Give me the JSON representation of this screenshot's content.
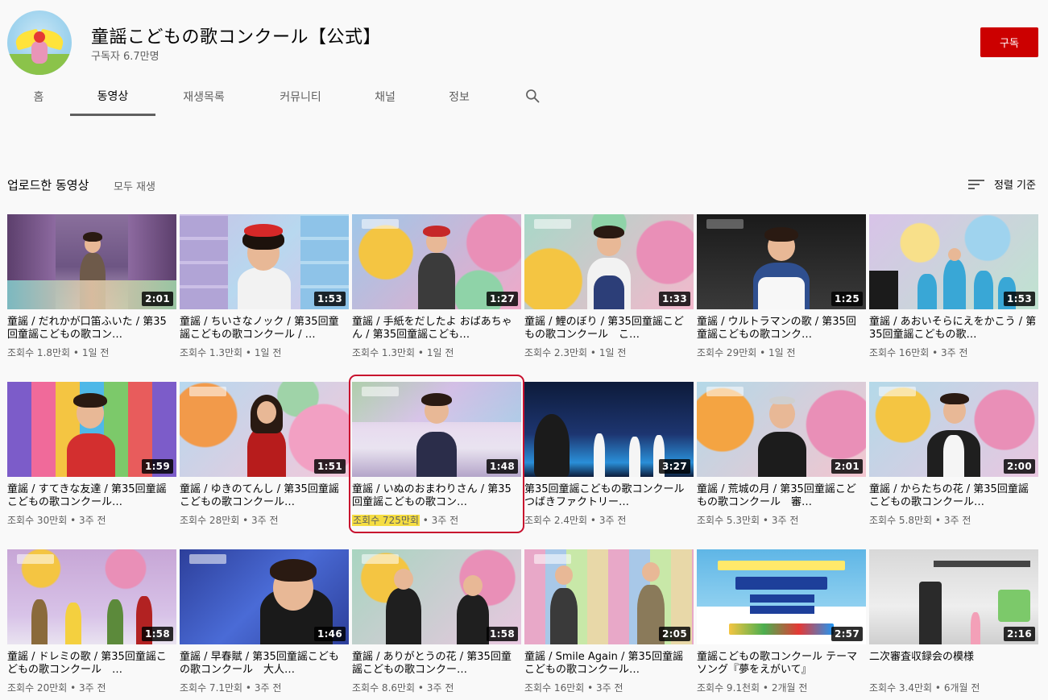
{
  "channel": {
    "title": "童謡こどもの歌コンクール【公式】",
    "subscribers": "구독자 6.7만명",
    "subscribe_label": "구독"
  },
  "tabs": [
    {
      "label": "홈",
      "active": false
    },
    {
      "label": "동영상",
      "active": true
    },
    {
      "label": "재생목록",
      "active": false
    },
    {
      "label": "커뮤니티",
      "active": false
    },
    {
      "label": "채널",
      "active": false
    },
    {
      "label": "정보",
      "active": false
    }
  ],
  "section": {
    "title": "업로드한 동영상",
    "play_all": "모두 재생",
    "sort_label": "정렬 기준"
  },
  "videos": [
    {
      "title": "童謡 / だれかが口笛ふいた / 第35回童謡こどもの歌コン…",
      "duration": "2:01",
      "views": "조회수 1.8만회",
      "age": "1일 전"
    },
    {
      "title": "童謡 / ちいさなノック / 第35回童謡こどもの歌コンクール / …",
      "duration": "1:53",
      "views": "조회수 1.3만회",
      "age": "1일 전"
    },
    {
      "title": "童謡 / 手紙をだしたよ おばあちゃん / 第35回童謡こども…",
      "duration": "1:27",
      "views": "조회수 1.3만회",
      "age": "1일 전"
    },
    {
      "title": "童謡 / 鯉のぼり / 第35回童謡こどもの歌コンクール　こ…",
      "duration": "1:33",
      "views": "조회수 2.3만회",
      "age": "1일 전"
    },
    {
      "title": "童謡 / ウルトラマンの歌 / 第35回童謡こどもの歌コンク…",
      "duration": "1:25",
      "views": "조회수 29만회",
      "age": "1일 전"
    },
    {
      "title": "童謡 / あおいそらにえをかこう / 第35回童謡こどもの歌…",
      "duration": "1:53",
      "views": "조회수 16만회",
      "age": "3주 전"
    },
    {
      "title": "童謡 / すてきな友達 / 第35回童謡こどもの歌コンクール…",
      "duration": "1:59",
      "views": "조회수 30만회",
      "age": "3주 전"
    },
    {
      "title": "童謡 / ゆきのてんし / 第35回童謡こどもの歌コンクール…",
      "duration": "1:51",
      "views": "조회수 28만회",
      "age": "3주 전"
    },
    {
      "title": "童謡 / いぬのおまわりさん / 第35回童謡こどもの歌コン…",
      "duration": "1:48",
      "views": "조회수 725만회",
      "age": "3주 전",
      "highlight": true
    },
    {
      "title": "第35回童謡こどもの歌コンクール　つばきファクトリー…",
      "duration": "3:27",
      "views": "조회수 2.4만회",
      "age": "3주 전"
    },
    {
      "title": "童謡 / 荒城の月 / 第35回童謡こどもの歌コンクール　審…",
      "duration": "2:01",
      "views": "조회수 5.3만회",
      "age": "3주 전"
    },
    {
      "title": "童謡 / からたちの花 / 第35回童謡こどもの歌コンクール…",
      "duration": "2:00",
      "views": "조회수 5.8만회",
      "age": "3주 전"
    },
    {
      "title": "童謡 / ドレミの歌 / 第35回童謡こどもの歌コンクール　…",
      "duration": "1:58",
      "views": "조회수 20만회",
      "age": "3주 전"
    },
    {
      "title": "童謡 / 早春賦 / 第35回童謡こどもの歌コンクール　大人…",
      "duration": "1:46",
      "views": "조회수 7.1만회",
      "age": "3주 전"
    },
    {
      "title": "童謡 / ありがとうの花 / 第35回童謡こどもの歌コンクー…",
      "duration": "1:58",
      "views": "조회수 8.6만회",
      "age": "3주 전"
    },
    {
      "title": "童謡 / Smile Again / 第35回童謡こどもの歌コンクール…",
      "duration": "2:05",
      "views": "조회수 16만회",
      "age": "3주 전"
    },
    {
      "title": "童謡こどもの歌コンクール テーマソング『夢をえがいて』",
      "duration": "2:57",
      "views": "조회수 9.1천회",
      "age": "2개월 전"
    },
    {
      "title": "二次審査収録会の模様",
      "duration": "2:16",
      "views": "조회수 3.4만회",
      "age": "6개월 전"
    }
  ],
  "colors": {
    "subscribe": "#cc0000",
    "highlight_box": "#c8102e",
    "views_highlight": "#f5dd42"
  }
}
